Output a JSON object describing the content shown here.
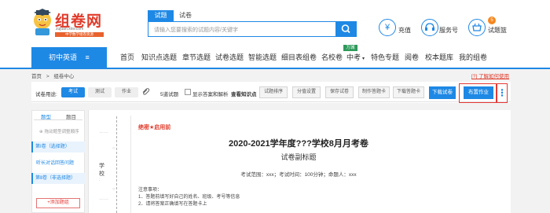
{
  "header": {
    "logo_text": "组卷网",
    "logo_sub": "zujuan.xkw.com",
    "logo_bar": "中学数学组卷资源",
    "search_tabs": [
      "试题",
      "试卷"
    ],
    "search_placeholder": "请输入您要搜索的试题内容/关键字",
    "actions": [
      {
        "icon": "yuan-icon",
        "label": "充值"
      },
      {
        "icon": "service-icon",
        "label": "服务号"
      },
      {
        "icon": "basket-icon",
        "label": "试题篮",
        "badge": "5"
      }
    ]
  },
  "nav": {
    "category": "初中英语",
    "items": [
      "首页",
      "知识点选题",
      "章节选题",
      "试卷选题",
      "智能选题",
      "细目表组卷",
      "名校卷",
      "中考",
      "特色专题",
      "阅卷",
      "校本题库",
      "我的组卷"
    ],
    "badge": "万城"
  },
  "breadcrumb": {
    "home": "首页",
    "sep": ">",
    "current": "组卷中心"
  },
  "help_link": "[?] 了解如何使用",
  "toolbar": {
    "usage_label": "试卷用途:",
    "usage_options": [
      "考试",
      "测试",
      "作业"
    ],
    "count_label": "5道试题",
    "show_answer_label": "显示答案和解析",
    "view_kp_label": "查看知识点",
    "buttons": [
      "试题排序",
      "分值设置",
      "保存试卷",
      "制作答题卡",
      "下载答题卡"
    ],
    "download_label": "下载试卷",
    "assign_label": "布置作业",
    "more_label": "⋮"
  },
  "left_panel": {
    "tabs": [
      "题型",
      "题目"
    ],
    "hint": "拖动题型调整顺序",
    "sections": [
      {
        "label": "第Ⅰ卷（选择题）"
      },
      {
        "label": "听长对话回答问题"
      },
      {
        "label": "第Ⅱ卷（非选择题）"
      }
    ],
    "add_label": "+添加题组"
  },
  "binding": {
    "chars": [
      "学",
      "校"
    ],
    "dots": [
      "○",
      "○"
    ],
    "marks": [
      "……",
      ":",
      "……"
    ]
  },
  "paper": {
    "secret": "绝密★启用前",
    "title": "2020-2021学年度???学校8月月考卷",
    "subtitle": "试卷副标题",
    "meta": "考试范围：xxx；考试时间：100分钟；命题人：xxx",
    "notes_title": "注意事项：",
    "notes": [
      "1．答题前填写好自己的姓名、班级、考号等信息",
      "2．请将答案正确填写在答题卡上"
    ]
  },
  "colors": {
    "accent": "#1e88e5",
    "red": "#e53935",
    "brand": "#e03b2a"
  }
}
